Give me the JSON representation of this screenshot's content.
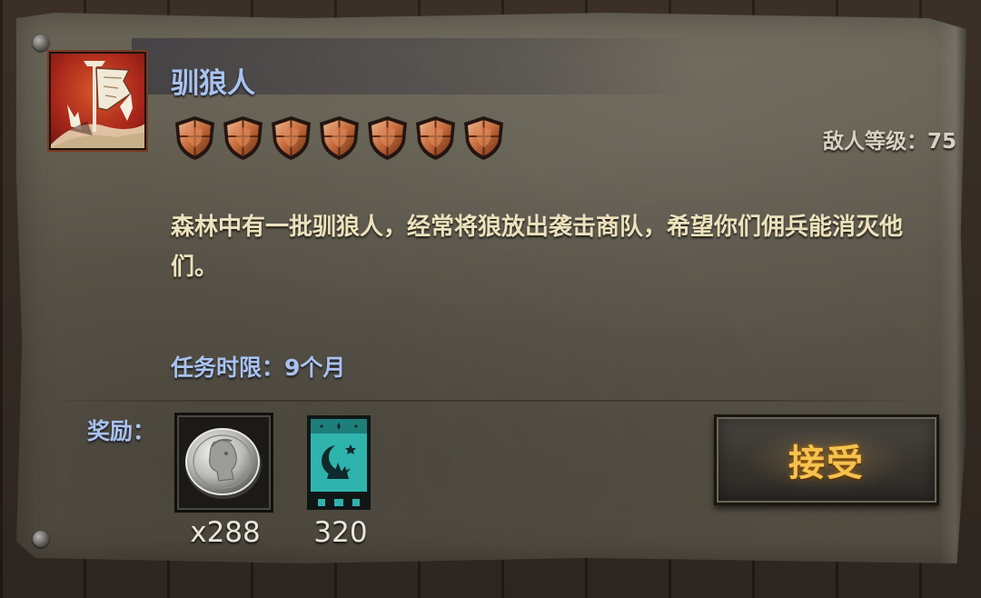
{
  "quest": {
    "title": "驯狼人",
    "icon": "wolf-tamer-banner-icon",
    "difficulty_badges": 7,
    "enemy_level_label": "敌人等级：75",
    "description": "森林中有一批驯狼人，经常将狼放出袭击商队，希望你们佣兵能消灭他们。",
    "time_limit_label": "任务时限：9个月"
  },
  "rewards": {
    "label": "奖励：",
    "items": [
      {
        "icon": "silver-coin-icon",
        "count": "x288"
      },
      {
        "icon": "faction-banner-icon",
        "count": "320"
      }
    ]
  },
  "actions": {
    "accept_label": "接受"
  },
  "colors": {
    "title_blue": "#a9c2ee",
    "description_text": "#ece2bd",
    "accept_gold": "#f6c24f",
    "parchment": "#5e594d",
    "banner_teal": "#2fb3ad"
  }
}
